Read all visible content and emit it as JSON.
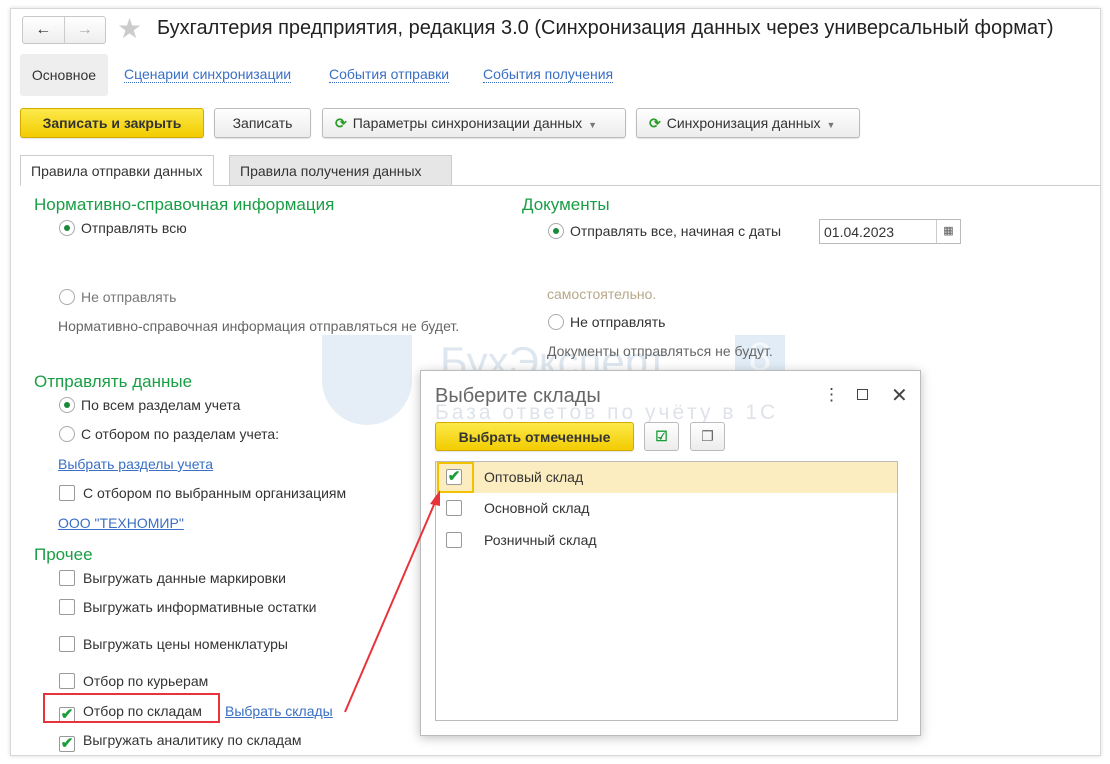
{
  "window": {
    "title": "Бухгалтерия предприятия, редакция 3.0 (Синхронизация данных через универсальный формат)"
  },
  "sections": [
    {
      "label": "Основное"
    },
    {
      "label": "Сценарии синхронизации"
    },
    {
      "label": "События отправки"
    },
    {
      "label": "События получения"
    }
  ],
  "toolbar": {
    "save_close": "Записать и закрыть",
    "save": "Записать",
    "params": "Параметры синхронизации данных",
    "sync": "Синхронизация данных"
  },
  "tabs": [
    {
      "label": "Правила отправки данных"
    },
    {
      "label": "Правила получения данных"
    }
  ],
  "nsi": {
    "heading": "Нормативно-справочная информация",
    "send_all": "Отправлять всю",
    "dont_send": "Не отправлять",
    "dont_send_note": "Нормативно-справочная информация отправляться не будет."
  },
  "docs": {
    "heading": "Документы",
    "send_from": "Отправлять все, начиная с даты",
    "date": "01.04.2023",
    "faint_note": "самостоятельно.",
    "dont_send": "Не отправлять",
    "dont_send_note": "Документы отправляться не будут."
  },
  "send_data": {
    "heading": "Отправлять данные",
    "all_sections": "По всем разделам учета",
    "by_sections": "С отбором по разделам учета:",
    "choose_sections": "Выбрать разделы учета",
    "by_orgs": "С отбором по выбранным организациям",
    "org": "ООО \"ТЕХНОМИР\""
  },
  "other": {
    "heading": "Прочее",
    "items": [
      {
        "label": "Выгружать данные маркировки",
        "checked": false
      },
      {
        "label": "Выгружать информативные остатки",
        "checked": false
      },
      {
        "label": "Выгружать цены номенклатуры",
        "checked": false
      },
      {
        "label": "Отбор по курьерам",
        "checked": false
      },
      {
        "label": "Отбор по складам",
        "checked": true
      },
      {
        "label": "Выгружать аналитику по складам",
        "checked": true
      }
    ],
    "choose_warehouses": "Выбрать склады"
  },
  "watermark": {
    "brand": "БухЭксперт",
    "badge": "8",
    "tagline": "База ответов по учёту в 1С"
  },
  "dialog": {
    "title": "Выберите склады",
    "select_checked": "Выбрать отмеченные",
    "items": [
      {
        "label": "Оптовый склад",
        "checked": true
      },
      {
        "label": "Основной склад",
        "checked": false
      },
      {
        "label": "Розничный склад",
        "checked": false
      }
    ]
  },
  "colors": {
    "accent_green": "#1a9e45",
    "link": "#3a6fc4",
    "highlight": "#e8333a",
    "yellow": "#f2cc00"
  }
}
